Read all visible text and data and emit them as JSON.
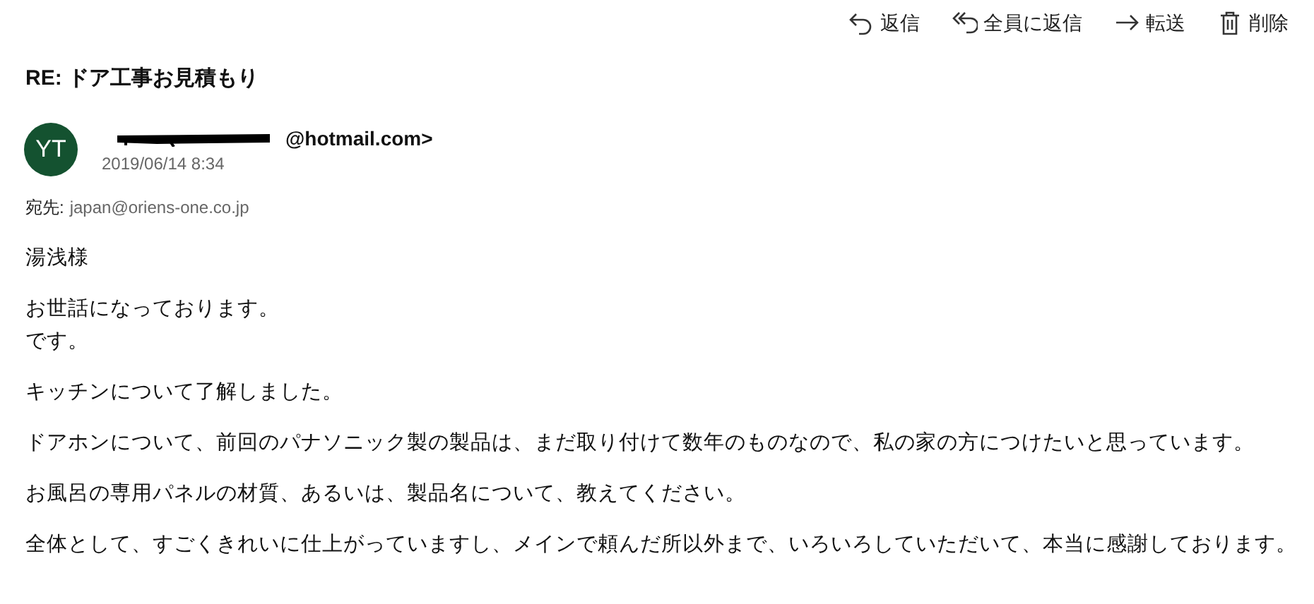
{
  "toolbar": [
    {
      "kind": "reply",
      "label": "返信"
    },
    {
      "kind": "reply_all",
      "label": "全員に返信"
    },
    {
      "kind": "forward",
      "label": "転送"
    },
    {
      "kind": "delete",
      "label": "削除"
    }
  ],
  "message": {
    "subject": "RE: ドア工事お見積もり",
    "avatar": "YT",
    "sender": "@hotmail.com>",
    "sender_redacted": true,
    "date": "2019/06/14 8:34",
    "to_label": "宛先:",
    "to": "japan@oriens-one.co.jp"
  },
  "body": [
    {
      "lines": [
        "湯浅様"
      ]
    },
    {
      "lines": [
        "お世話になっております。",
        "です。"
      ]
    },
    {
      "lines": [
        "キッチンについて了解しました。"
      ]
    },
    {
      "lines": [
        "ドアホンについて、前回のパナソニック製の製品は、まだ取り付けて数年のものなので、私の家の方につけたいと思っています。"
      ]
    },
    {
      "lines": [
        "お風呂の専用パネルの材質、あるいは、製品名について、教えてください。"
      ]
    },
    {
      "lines": [
        "全体として、すごくきれいに仕上がっていますし、メインで頼んだ所以外まで、いろいろしていただいて、本当に感謝しております。"
      ]
    }
  ]
}
